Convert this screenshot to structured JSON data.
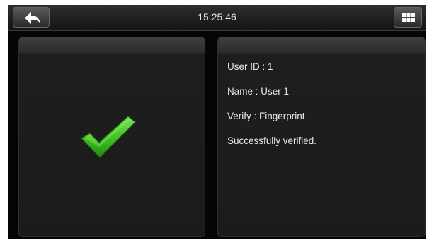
{
  "header": {
    "time": "15:25:46",
    "back_icon": "back-arrow-icon",
    "menu_icon": "grid-menu-icon"
  },
  "result": {
    "status_icon": "checkmark-icon",
    "status_color": "#3fbf1f"
  },
  "details": {
    "user_id": "User ID : 1",
    "name": "Name : User 1",
    "verify": "Verify : Fingerprint",
    "message": "Successfully verified."
  },
  "colors": {
    "screen_bg": "#050505",
    "panel_bg": "#1b1b1b",
    "text": "#e8e8e8"
  }
}
